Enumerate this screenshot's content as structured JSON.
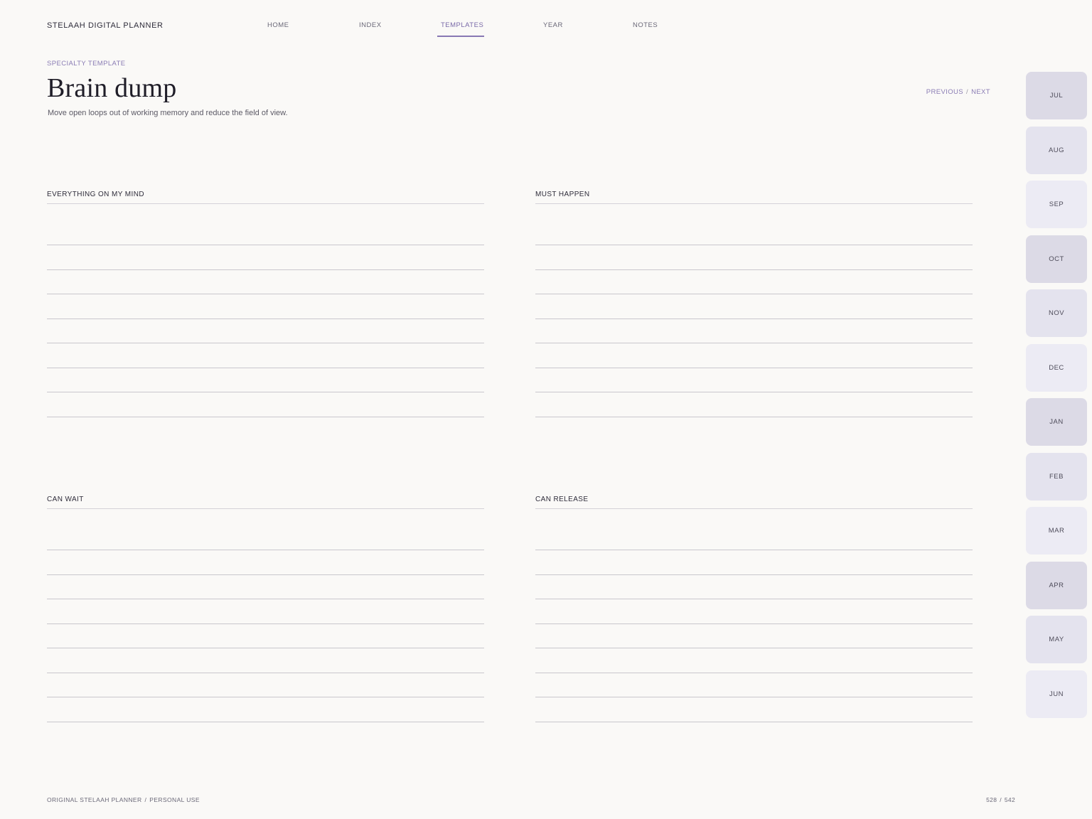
{
  "brand": "STELAAH DIGITAL PLANNER",
  "nav": [
    {
      "label": "HOME",
      "active": false
    },
    {
      "label": "INDEX",
      "active": false
    },
    {
      "label": "TEMPLATES",
      "active": true
    },
    {
      "label": "YEAR",
      "active": false
    },
    {
      "label": "NOTES",
      "active": false
    }
  ],
  "header": {
    "eyebrow": "SPECIALTY TEMPLATE",
    "title": "Brain dump",
    "subtitle": "Move open loops out of working memory and reduce the field of view.",
    "previous": "PREVIOUS",
    "separator": "/",
    "next": "NEXT"
  },
  "sections": [
    {
      "label": "EVERYTHING ON MY MIND"
    },
    {
      "label": "MUST HAPPEN"
    },
    {
      "label": "CAN WAIT"
    },
    {
      "label": "CAN RELEASE"
    }
  ],
  "months": [
    "JUL",
    "AUG",
    "SEP",
    "OCT",
    "NOV",
    "DEC",
    "JAN",
    "FEB",
    "MAR",
    "APR",
    "MAY",
    "JUN"
  ],
  "footer": {
    "left_a": "ORIGINAL STELAAH PLANNER",
    "left_sep": "/",
    "left_b": "PERSONAL USE",
    "page_current": "528",
    "page_sep": "/",
    "page_total": "542"
  },
  "colors": {
    "background": "#faf9f7",
    "accent": "#8878b4",
    "tab_dark": "#dcdae6",
    "tab_mid": "#e4e3ee",
    "tab_light": "#ecebf4"
  }
}
